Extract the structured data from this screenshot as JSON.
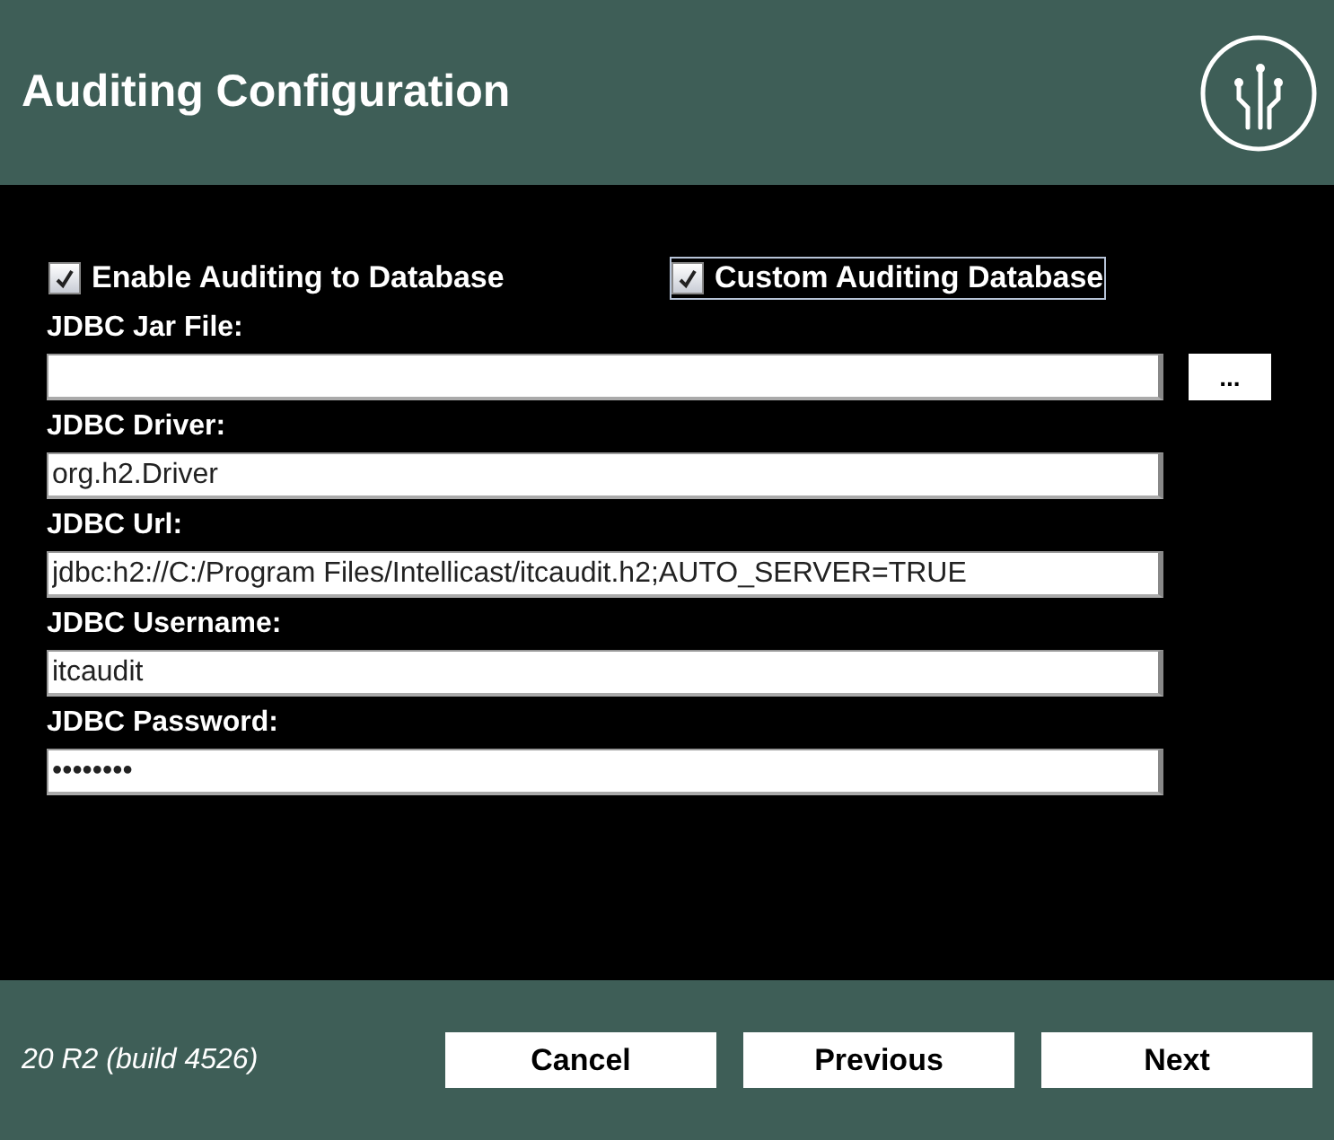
{
  "window": {
    "title": "Auditing Configuration"
  },
  "checkboxes": [
    {
      "label": "Enable Auditing to Database",
      "checked": true,
      "focused": false
    },
    {
      "label": "Custom Auditing Database",
      "checked": true,
      "focused": true
    }
  ],
  "fields": [
    {
      "label": "JDBC Jar File:",
      "browse": "..."
    },
    {
      "label": "JDBC Driver:",
      "value": "org.h2.Driver"
    },
    {
      "label": "JDBC Url:",
      "value": "jdbc:h2://C:/Program Files/Intellicast/itcaudit.h2;AUTO_SERVER=TRUE"
    },
    {
      "label": "JDBC Username:",
      "value": "itcaudit"
    },
    {
      "label": "JDBC Password:",
      "value": "••••••••"
    }
  ],
  "footer": {
    "version": "20 R2 (build 4526)",
    "buttons": [
      "Cancel",
      "Previous",
      "Next"
    ]
  }
}
